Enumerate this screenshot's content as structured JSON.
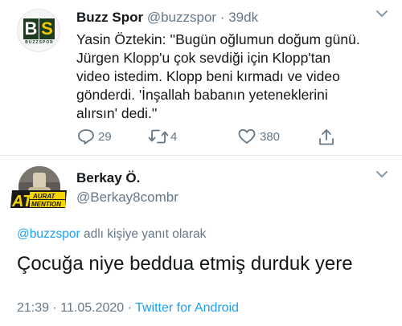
{
  "tweet": {
    "display_name": "Buzz Spor",
    "handle": "@buzzspor",
    "separator": " · ",
    "time": "39dk",
    "avatar_text": {
      "b": "B",
      "s": "S",
      "sub": "BUZZSPOR"
    },
    "lines": [
      "Yasin Öztekin: ''Bugün oğlumun doğum günü.",
      "Jürgen Klopp'u çok sevdiği için Klopp'tan",
      "video istedim. Klopp beni kırmadı ve video",
      "gönderdi. 'İnşallah babanın yeteneklerini",
      "alırsın' dedi.''"
    ],
    "actions": {
      "reply_count": "29",
      "retweet_count": "4",
      "like_count": "380"
    }
  },
  "reply": {
    "display_name": "Berkay Ö.",
    "handle": "@Berkay8combr",
    "badge_text": {
      "at": "AT",
      "top": "AURAT",
      "bottom": "MENTION"
    },
    "replying_to_mention": "@buzzspor",
    "replying_to_suffix": " adlı kişiye yanıt olarak",
    "text": "Çocuğa niye beddua etmiş durduk yere",
    "time": "21:39",
    "date": "11.05.2020",
    "meta_separator": " · ",
    "source": "Twitter for Android"
  },
  "colors": {
    "accent": "#1da1f2",
    "secondary_text": "#657786",
    "primary_text": "#14171a",
    "divider": "#e1e8ed"
  },
  "icons": [
    "chevron-down-icon",
    "reply-icon",
    "retweet-icon",
    "like-icon",
    "share-icon"
  ]
}
